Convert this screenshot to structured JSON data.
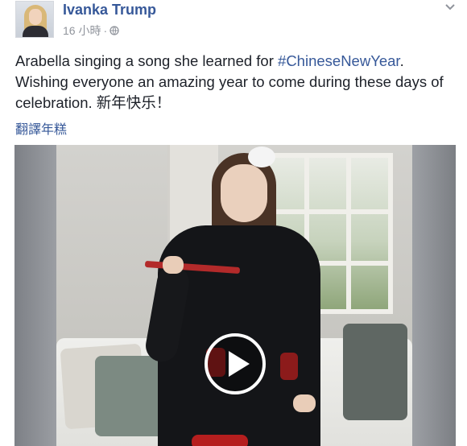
{
  "post": {
    "author": "Ivanka Trump",
    "time": "16 小時",
    "separator": "·",
    "text_intro": "Arabella singing a song she learned for ",
    "hashtag": "#ChineseNewYear",
    "text_rest": ". Wishing everyone an amazing year to come during these days of celebration. 新年快乐！",
    "translate_label": "翻譯年糕"
  },
  "icons": {
    "privacy": "globe-icon",
    "menu": "chevron-down-icon",
    "video": "play-icon"
  },
  "colors": {
    "link": "#365899",
    "meta": "#90949c",
    "text": "#1d2129"
  }
}
